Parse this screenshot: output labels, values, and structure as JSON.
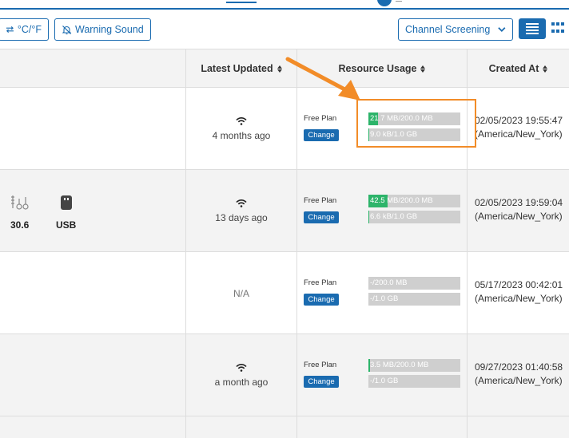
{
  "toolbar": {
    "unit_label": "°C/°F",
    "warning_label": "Warning Sound",
    "channel_label": "Channel Screening"
  },
  "table": {
    "headers": {
      "latest_updated": "Latest Updated",
      "resource_usage": "Resource Usage",
      "created_at": "Created At"
    },
    "rows": [
      {
        "updated": "4 months ago",
        "has_wifi": true,
        "plan": "Free Plan",
        "change": "Change",
        "usage1": "21.7 MB/200.0 MB",
        "usage1_pct": 10.85,
        "usage2": "9.0 kB/1.0 GB",
        "usage2_pct": 0.9,
        "created_date": "02/05/2023 19:55:47",
        "created_tz": "(America/New_York)"
      },
      {
        "updated": "13 days ago",
        "has_wifi": true,
        "plan": "Free Plan",
        "change": "Change",
        "usage1": "42.5 MB/200.0 MB",
        "usage1_pct": 21.25,
        "usage2": "6.6 kB/1.0 GB",
        "usage2_pct": 0.66,
        "created_date": "02/05/2023 19:59:04",
        "created_tz": "(America/New_York)",
        "device_value": "30.6",
        "device_port": "USB"
      },
      {
        "updated": "N/A",
        "has_wifi": false,
        "plan": "Free Plan",
        "change": "Change",
        "usage1": "-/200.0 MB",
        "usage1_pct": 0,
        "usage2": "-/1.0 GB",
        "usage2_pct": 0,
        "created_date": "05/17/2023 00:42:01",
        "created_tz": "(America/New_York)"
      },
      {
        "updated": "a month ago",
        "has_wifi": true,
        "plan": "Free Plan",
        "change": "Change",
        "usage1": "3.5 MB/200.0 MB",
        "usage1_pct": 1.75,
        "usage2": "-/1.0 GB",
        "usage2_pct": 0,
        "created_date": "09/27/2023 01:40:58",
        "created_tz": "(America/New_York)"
      }
    ]
  },
  "colors": {
    "accent": "#1a6bb0",
    "usage_fill": "#2db46a",
    "usage_track": "#cfcfcf",
    "highlight": "#f28c28"
  }
}
